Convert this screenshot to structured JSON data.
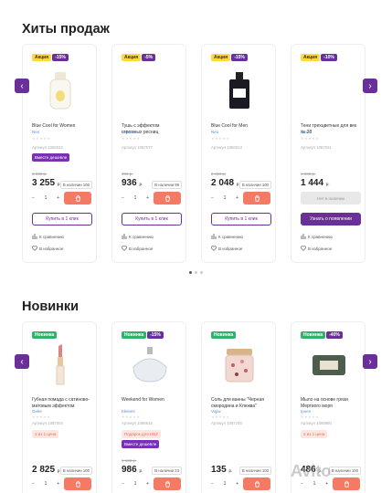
{
  "sections": {
    "hits_title": "Хиты продаж",
    "new_title": "Новинки"
  },
  "hits": [
    {
      "badge_promo": "Акция",
      "badge_disc": "-15%",
      "name": "Blue Cool for Women",
      "brand": "Neo",
      "sku": "Артикул 1068312",
      "tag": "Вместе дешевле",
      "old_price": "3 830 р.",
      "price": "3 255",
      "currency": "р.",
      "stock": "В наличии 100",
      "buy": "Купить в 1 клик"
    },
    {
      "badge_promo": "Акция",
      "badge_disc": "-5%",
      "name": "Тушь с эффектом огромных ресниц",
      "brand": "Venebe",
      "sku": "Артикул 1087077",
      "old_price": "985 р.",
      "price": "936",
      "currency": "р.",
      "stock": "В наличии 99",
      "buy": "Купить в 1 клик"
    },
    {
      "badge_promo": "Акция",
      "badge_disc": "-15%",
      "name": "Blue Cool for Men",
      "brand": "Neo",
      "sku": "Артикул 1068313",
      "old_price": "2 410 р.",
      "price": "2 048",
      "currency": "р.",
      "stock": "В наличии 100",
      "buy": "Купить в 1 клик"
    },
    {
      "badge_promo": "Акция",
      "badge_disc": "-10%",
      "name": "Тени трехцветные для век № 28",
      "brand": "Zeve",
      "sku": "Артикул 1087021",
      "old_price": "1 605 р.",
      "price": "1 444",
      "currency": "р.",
      "notify_gray": "Нет в наличии",
      "notify": "Узнать о появлении"
    }
  ],
  "common": {
    "qty_minus": "−",
    "qty_value": "1",
    "qty_plus": "+",
    "compare": "К сравнению",
    "favorite": "В избранное"
  },
  "news": [
    {
      "badge_new": "Новинка",
      "name": "Губная помада с сатиново-матовым эффектом",
      "brand": "Geke",
      "sku": "Артикул 1087004",
      "tag": "2 из 1 цена",
      "price": "2 825",
      "currency": "р.",
      "stock": "В наличии 100"
    },
    {
      "badge_new": "Новинка",
      "badge_disc": "-15%",
      "name": "Weekend for Women",
      "brand": "Kleines",
      "sku": "Артикул 1086615",
      "tag_gift": "Подарок для HBZ",
      "tag": "Вместе дешевле",
      "old_price": "1 160 р.",
      "price": "986",
      "currency": "р.",
      "stock": "В наличии 23"
    },
    {
      "badge_new": "Новинка",
      "name": "Соль для ванны \"Черная смородина и Клюква\"",
      "brand": "Vojiw",
      "sku": "Артикул 1087245",
      "price": "135",
      "currency": "р.",
      "stock": "В наличии 100"
    },
    {
      "badge_new": "Новинка",
      "badge_disc": "-40%",
      "name": "Мыло на основе грязи Мертвого моря",
      "brand": "Ipoen",
      "sku": "Артикул 1086890",
      "tag": "2 из 1 цена",
      "price": "486",
      "currency": "р.",
      "stock": "В наличии 100"
    }
  ],
  "watermark": "Avito"
}
